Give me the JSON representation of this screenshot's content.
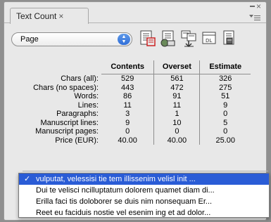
{
  "panel": {
    "tab_label": "Text Count",
    "tab_close": "×",
    "close_glyph": "×"
  },
  "toolbar": {
    "scope_select_value": "Page",
    "buttons": [
      "count-document-icon",
      "count-with-page-icon",
      "export-count-icon",
      "columns-icon",
      "settings-icon"
    ]
  },
  "table": {
    "headers": [
      "Contents",
      "Overset",
      "Estimate"
    ],
    "rows": [
      {
        "label": "Chars (all):",
        "contents": "529",
        "overset": "561",
        "estimate": "326"
      },
      {
        "label": "Chars (no spaces):",
        "contents": "443",
        "overset": "472",
        "estimate": "275"
      },
      {
        "label": "Words:",
        "contents": "86",
        "overset": "91",
        "estimate": "51"
      },
      {
        "label": "Lines:",
        "contents": "11",
        "overset": "11",
        "estimate": "9"
      },
      {
        "label": "Paragraphs:",
        "contents": "3",
        "overset": "1",
        "estimate": "0"
      },
      {
        "label": "Manuscript lines:",
        "contents": "9",
        "overset": "10",
        "estimate": "5"
      },
      {
        "label": "Manuscript pages:",
        "contents": "0",
        "overset": "0",
        "estimate": "0"
      },
      {
        "label": "Price (EUR):",
        "contents": "40.00",
        "overset": "40.00",
        "estimate": "25.00"
      }
    ]
  },
  "dropdown": {
    "check": "✓",
    "items": [
      "vulputat, velessisi tie tem illissenim velisl init ...",
      "Dui te velisci ncilluptatum dolorem quamet diam di...",
      "Erilla faci tis doloborer se duis nim nonsequam Er...",
      "Reet eu faciduis nostie vel esenim ing et ad dolor..."
    ]
  },
  "colors": {
    "selection": "#2a5cd6",
    "select_arrow": "#2f6ed8"
  }
}
